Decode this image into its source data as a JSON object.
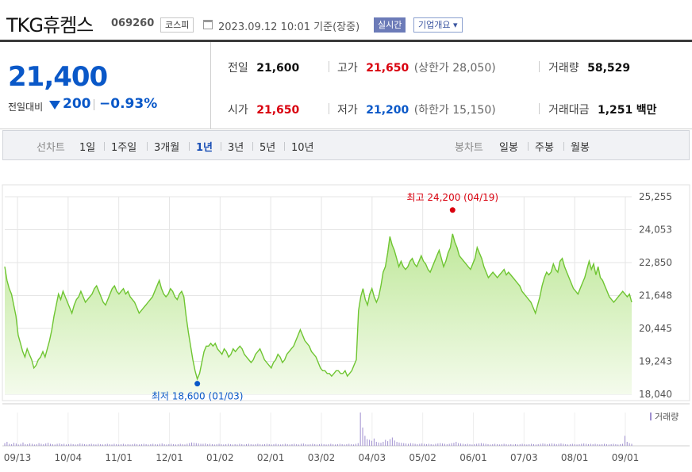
{
  "header": {
    "name": "TKG휴켐스",
    "code": "069260",
    "market": "코스피",
    "datetime": "2023.09.12 10:01 기준(장중)",
    "realtime": "실시간",
    "company_info": "기업개요 ▾"
  },
  "price": {
    "current": "21,400",
    "change_label": "전일대비",
    "change_value": "200",
    "change_pct": "−0.93%",
    "direction": "down"
  },
  "stats": {
    "prev_close_label": "전일",
    "prev_close": "21,600",
    "high_label": "고가",
    "high": "21,650",
    "upper_limit": "(상한가 28,050)",
    "volume_label": "거래량",
    "volume": "58,529",
    "open_label": "시가",
    "open": "21,650",
    "low_label": "저가",
    "low": "21,200",
    "lower_limit": "(하한가 15,150)",
    "amount_label": "거래대금",
    "amount": "1,251",
    "amount_unit": "백만"
  },
  "tabs": {
    "line_label": "선차트",
    "line_periods": [
      "1일",
      "1주일",
      "3개월",
      "1년",
      "3년",
      "5년",
      "10년"
    ],
    "active": "1년",
    "candle_label": "봉차트",
    "candle_periods": [
      "일봉",
      "주봉",
      "월봉"
    ]
  },
  "colors": {
    "up": "#d9000e",
    "down": "#0a58c8",
    "area_line": "#6fc532",
    "area_fill_top": "#bfe89a",
    "area_fill_bottom": "#f4fbec",
    "volume_bar": "#9f8fcf"
  },
  "chart_data": {
    "type": "area",
    "y_ticks": [
      "25,255",
      "24,053",
      "22,850",
      "21,648",
      "20,445",
      "19,243",
      "18,040"
    ],
    "ylim": [
      18040,
      25255
    ],
    "x_ticks": [
      "09/13",
      "10/04",
      "11/01",
      "12/01",
      "01/02",
      "02/01",
      "03/02",
      "04/03",
      "05/02",
      "06/01",
      "07/03",
      "08/01",
      "09/01"
    ],
    "high_label": "최고 24,200 (04/19)",
    "low_label": "최저 18,600 (01/03)",
    "volume_label": "거래량",
    "series": [
      {
        "values": [
          22700,
          22200,
          21900,
          21700,
          21300,
          20900,
          20200,
          19900,
          19600,
          19400,
          19700,
          19500,
          19300,
          19000,
          19100,
          19300,
          19400,
          19600,
          19400,
          19700,
          20000,
          20400,
          20900,
          21300,
          21700,
          21500,
          21800,
          21600,
          21400,
          21200,
          21000,
          21300,
          21500,
          21600,
          21800,
          21600,
          21400,
          21500,
          21600,
          21700,
          21900,
          22000,
          21800,
          21600,
          21400,
          21300,
          21500,
          21700,
          21900,
          22000,
          21800,
          21700,
          21800,
          21900,
          21700,
          21800,
          21600,
          21500,
          21400,
          21200,
          21000,
          21100,
          21200,
          21300,
          21400,
          21500,
          21600,
          21800,
          22000,
          22200,
          21900,
          21700,
          21600,
          21700,
          21900,
          21800,
          21600,
          21500,
          21700,
          21800,
          21600,
          20900,
          20300,
          19800,
          19300,
          18900,
          18600,
          18800,
          19200,
          19600,
          19800,
          19800,
          19900,
          19800,
          19900,
          19700,
          19600,
          19500,
          19700,
          19600,
          19400,
          19500,
          19700,
          19600,
          19700,
          19800,
          19700,
          19500,
          19400,
          19300,
          19200,
          19300,
          19500,
          19600,
          19700,
          19500,
          19300,
          19200,
          19100,
          19000,
          19200,
          19300,
          19500,
          19400,
          19200,
          19300,
          19500,
          19600,
          19700,
          19800,
          20000,
          20200,
          20400,
          20200,
          20000,
          19900,
          19800,
          19600,
          19500,
          19400,
          19200,
          19000,
          18900,
          18900,
          18800,
          18800,
          18700,
          18800,
          18900,
          18900,
          18800,
          18800,
          18900,
          18700,
          18800,
          18900,
          19100,
          19300,
          21100,
          21600,
          21900,
          21500,
          21300,
          21700,
          21900,
          21600,
          21400,
          21600,
          22000,
          22500,
          22700,
          23200,
          23800,
          23500,
          23300,
          23000,
          22700,
          22900,
          22700,
          22600,
          22700,
          22900,
          23000,
          22800,
          22700,
          22900,
          23100,
          22900,
          22800,
          22600,
          22500,
          22700,
          22900,
          23100,
          23300,
          23000,
          22700,
          22900,
          23200,
          23400,
          23900,
          23600,
          23400,
          23100,
          23000,
          22900,
          22800,
          22700,
          22600,
          22800,
          23000,
          23400,
          23200,
          23000,
          22700,
          22500,
          22300,
          22400,
          22500,
          22400,
          22300,
          22400,
          22500,
          22600,
          22400,
          22500,
          22400,
          22300,
          22200,
          22100,
          22000,
          21800,
          21700,
          21600,
          21500,
          21400,
          21200,
          21000,
          21300,
          21600,
          22000,
          22300,
          22500,
          22400,
          22500,
          22800,
          22600,
          22500,
          22900,
          23000,
          22700,
          22500,
          22300,
          22100,
          21900,
          21800,
          21700,
          21900,
          22100,
          22300,
          22600,
          22900,
          22600,
          22800,
          22400,
          22700,
          22300,
          22200,
          22000,
          21800,
          21600,
          21500,
          21400,
          21500,
          21600,
          21700,
          21800,
          21700,
          21600,
          21700,
          21400
        ]
      }
    ],
    "volume": [
      0.08,
      0.12,
      0.06,
      0.05,
      0.09,
      0.07,
      0.04,
      0.06,
      0.1,
      0.05,
      0.05,
      0.07,
      0.06,
      0.04,
      0.05,
      0.08,
      0.06,
      0.05,
      0.07,
      0.09,
      0.06,
      0.05,
      0.04,
      0.06,
      0.07,
      0.05,
      0.06,
      0.04,
      0.05,
      0.06,
      0.05,
      0.04,
      0.05,
      0.07,
      0.06,
      0.05,
      0.04,
      0.05,
      0.06,
      0.05,
      0.04,
      0.06,
      0.05,
      0.04,
      0.05,
      0.06,
      0.05,
      0.04,
      0.06,
      0.05,
      0.04,
      0.05,
      0.06,
      0.04,
      0.05,
      0.04,
      0.05,
      0.06,
      0.05,
      0.04,
      0.05,
      0.06,
      0.05,
      0.04,
      0.05,
      0.06,
      0.05,
      0.04,
      0.06,
      0.07,
      0.05,
      0.04,
      0.05,
      0.06,
      0.05,
      0.04,
      0.05,
      0.06,
      0.05,
      0.04,
      0.06,
      0.08,
      0.1,
      0.09,
      0.08,
      0.07,
      0.06,
      0.06,
      0.07,
      0.05,
      0.06,
      0.05,
      0.04,
      0.05,
      0.06,
      0.05,
      0.04,
      0.05,
      0.06,
      0.05,
      0.04,
      0.05,
      0.04,
      0.06,
      0.05,
      0.04,
      0.05,
      0.06,
      0.05,
      0.04,
      0.05,
      0.06,
      0.05,
      0.04,
      0.05,
      0.06,
      0.05,
      0.04,
      0.05,
      0.06,
      0.05,
      0.04,
      0.05,
      0.06,
      0.05,
      0.04,
      0.05,
      0.06,
      0.05,
      0.04,
      0.06,
      0.07,
      0.05,
      0.04,
      0.05,
      0.06,
      0.05,
      0.04,
      0.05,
      0.06,
      0.05,
      0.04,
      0.05,
      0.06,
      0.05,
      0.04,
      0.05,
      0.06,
      0.05,
      0.04,
      0.05,
      0.06,
      0.05,
      0.04,
      0.06,
      0.08,
      1.0,
      0.55,
      0.3,
      0.2,
      0.18,
      0.15,
      0.22,
      0.12,
      0.1,
      0.09,
      0.12,
      0.18,
      0.14,
      0.2,
      0.25,
      0.16,
      0.12,
      0.1,
      0.09,
      0.08,
      0.07,
      0.06,
      0.08,
      0.07,
      0.06,
      0.05,
      0.06,
      0.07,
      0.06,
      0.05,
      0.06,
      0.05,
      0.04,
      0.06,
      0.07,
      0.08,
      0.07,
      0.06,
      0.05,
      0.06,
      0.08,
      0.09,
      0.12,
      0.08,
      0.07,
      0.06,
      0.05,
      0.06,
      0.05,
      0.04,
      0.05,
      0.06,
      0.07,
      0.08,
      0.07,
      0.06,
      0.05,
      0.04,
      0.05,
      0.06,
      0.05,
      0.04,
      0.05,
      0.06,
      0.05,
      0.04,
      0.05,
      0.04,
      0.05,
      0.04,
      0.05,
      0.06,
      0.05,
      0.04,
      0.05,
      0.06,
      0.05,
      0.04,
      0.05,
      0.06,
      0.07,
      0.06,
      0.05,
      0.06,
      0.07,
      0.06,
      0.05,
      0.06,
      0.07,
      0.06,
      0.05,
      0.04,
      0.05,
      0.06,
      0.05,
      0.04,
      0.05,
      0.06,
      0.07,
      0.06,
      0.05,
      0.06,
      0.05,
      0.06,
      0.05,
      0.04,
      0.05,
      0.06,
      0.05,
      0.04,
      0.05,
      0.06,
      0.05,
      0.04,
      0.05,
      0.06,
      0.3,
      0.12,
      0.08,
      0.06
    ]
  }
}
